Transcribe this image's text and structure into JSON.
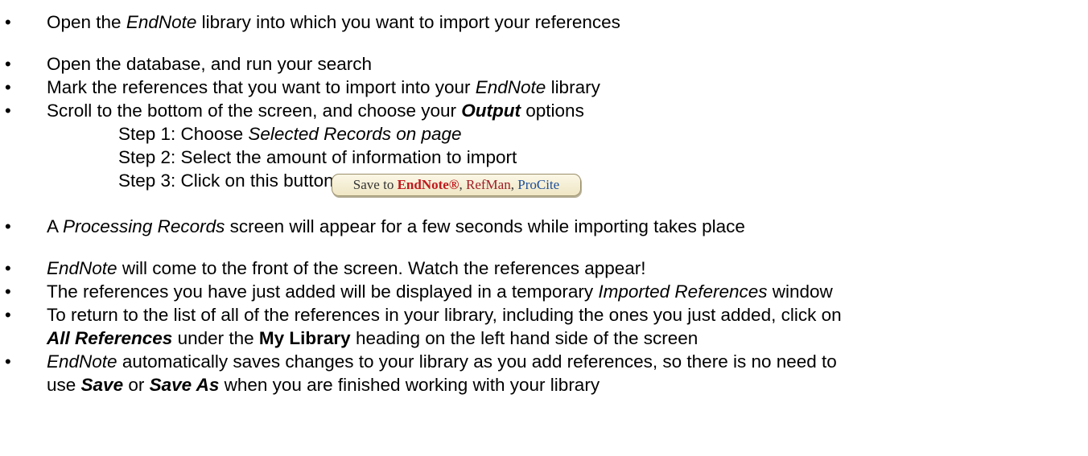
{
  "bullet_char": "•",
  "bullets": [
    {
      "pre": "Open the ",
      "em": "EndNote",
      "post": " library into which you want to import your references"
    },
    {
      "text": "Open the database, and run your search"
    },
    {
      "pre": "Mark the references that you want to import into your ",
      "em": "EndNote",
      "post": " library"
    },
    {
      "pre": "Scroll to the bottom of the screen, and choose your ",
      "strong": "Output",
      "post": " options"
    }
  ],
  "steps": [
    {
      "label": "Step 1:  Choose ",
      "em": "Selected Records on page"
    },
    {
      "label": "Step 2:  Select the amount of information to import"
    },
    {
      "label": "Step 3:  Click on this button"
    }
  ],
  "save_button": {
    "prefix": "Save to ",
    "endnote": "EndNote®",
    "sep1": ", ",
    "refman": "RefMan",
    "sep2": ", ",
    "procite": "ProCite",
    "colors": {
      "endnote": "#c0181e",
      "refman": "#a01c25",
      "procite": "#1a4d9a"
    }
  },
  "bullets2": [
    {
      "pre": "A ",
      "em": "Processing Records",
      "post": " screen will appear for a few seconds while importing takes place"
    },
    {
      "em": "EndNote",
      "post": " will come to the front of the screen.  Watch the references appear!"
    },
    {
      "pre": "The references you have just added will be displayed in a temporary ",
      "em": "Imported References",
      "post": " window"
    },
    {
      "line1": "To return to the list of all of the references in your library, including the ones you just added, click on",
      "l2_strong_em": "All References",
      "l2_mid": " under the ",
      "l2_strong": "My Library",
      "l2_post": " heading on the left hand side of the screen"
    },
    {
      "em": "EndNote",
      "line1_post": " automatically saves changes to your library as you add references, so there is no need to",
      "l2_pre": "use ",
      "l2_save": "Save",
      "l2_or": " or ",
      "l2_saveas": "Save As",
      "l2_post": " when you are finished working with your library"
    }
  ]
}
